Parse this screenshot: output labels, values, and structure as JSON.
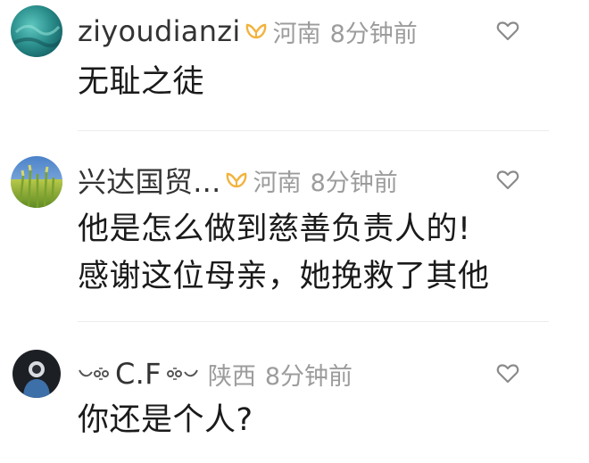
{
  "comments": [
    {
      "username": "ziyoudianzi",
      "location": "河南",
      "time": "8分钟前",
      "lines": [
        "无耻之徒"
      ]
    },
    {
      "username": "兴达国贸...",
      "location": "河南",
      "time": "8分钟前",
      "lines": [
        "他是怎么做到慈善负责人的!",
        "感谢这位母亲，她挽救了其他"
      ]
    },
    {
      "username": "C.F",
      "location": "陕西",
      "time": "8分钟前",
      "lines": [
        "你还是个人?"
      ]
    }
  ],
  "colors": {
    "username": "#333333",
    "meta": "#9c9c9c",
    "content": "#1a1a1a",
    "badge": "#f2b33d",
    "divider": "#ececec"
  },
  "icons": [
    "avatar",
    "vip-badge-icon",
    "heart-icon",
    "ornament-icon"
  ]
}
